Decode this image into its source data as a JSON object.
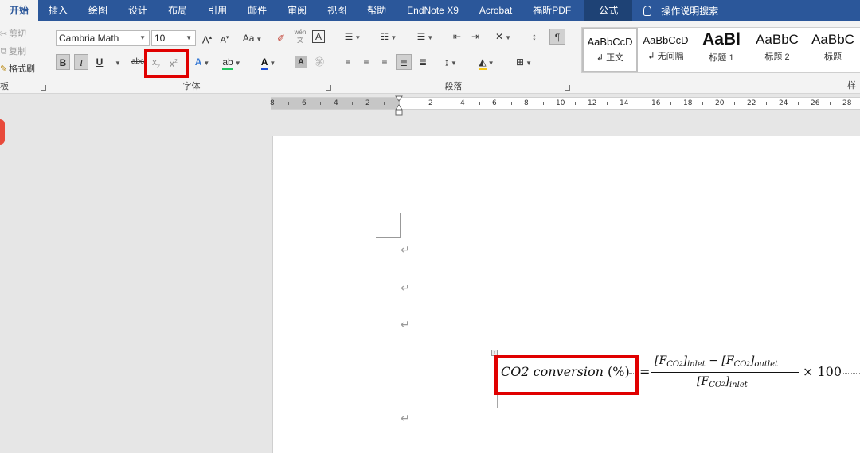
{
  "tabs": [
    {
      "label": "开始",
      "active": true
    },
    {
      "label": "插入"
    },
    {
      "label": "绘图"
    },
    {
      "label": "设计"
    },
    {
      "label": "布局"
    },
    {
      "label": "引用"
    },
    {
      "label": "邮件"
    },
    {
      "label": "审阅"
    },
    {
      "label": "视图"
    },
    {
      "label": "帮助"
    },
    {
      "label": "EndNote X9"
    },
    {
      "label": "Acrobat"
    },
    {
      "label": "福昕PDF"
    },
    {
      "label": "公式"
    }
  ],
  "tell_me": "操作说明搜索",
  "clipboard": {
    "cut": "剪切",
    "copy": "复制",
    "format_painter": "格式刷",
    "group_label": "板"
  },
  "font": {
    "name": "Cambria Math",
    "size": "10",
    "grow": "A",
    "shrink": "A",
    "case": "Aa",
    "phonetic": "wén",
    "char_border": "A",
    "bold": "B",
    "italic": "I",
    "underline": "U",
    "strikethrough": "abc",
    "subscript": "x",
    "superscript": "x",
    "text_effects": "A",
    "font_color": "A",
    "char_shading": "A",
    "group_label": "字体"
  },
  "paragraph": {
    "group_label": "段落"
  },
  "styles": {
    "items": [
      {
        "preview": "AaBbCcD",
        "name": "正文",
        "selected": true
      },
      {
        "preview": "AaBbCcD",
        "name": "无间隔"
      },
      {
        "preview": "AaBl",
        "name": "标题 1"
      },
      {
        "preview": "AaBbC",
        "name": "标题 2"
      },
      {
        "preview": "AaBbC",
        "name": "标题"
      }
    ],
    "group_label": "样"
  },
  "ruler": {
    "labels": [
      "8",
      "6",
      "4",
      "2",
      "2",
      "4",
      "6",
      "8",
      "10",
      "12",
      "14",
      "16",
      "18",
      "20",
      "22",
      "24",
      "26",
      "28"
    ]
  },
  "document": {
    "paragraph_mark": "↵",
    "equation": {
      "lhs_text": "CO2 conversion",
      "lhs_unit": "(%)",
      "equals": "=",
      "numerator_inlet": "[F",
      "sub_co": "CO",
      "sub_2": "2",
      "inlet": "inlet",
      "minus": "−",
      "outlet": "outlet",
      "times": "× 100"
    }
  }
}
